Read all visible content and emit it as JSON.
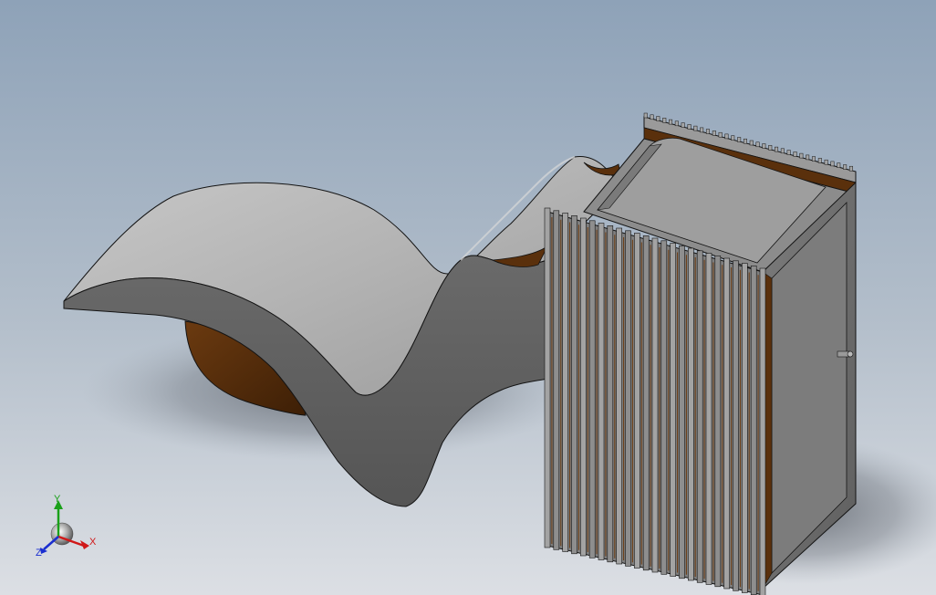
{
  "viewport": {
    "background_top": "#8ea2b8",
    "background_bottom": "#d9dde3"
  },
  "model": {
    "surface_color": "#6e6e6e",
    "surface_light": "#b9b9b9",
    "interior_color": "#4a2a0c",
    "edge_color": "#141414",
    "fin_color": "#8a8a8a"
  },
  "triad": {
    "x_label": "X",
    "y_label": "Y",
    "z_label": "Z",
    "x_color": "#d01818",
    "y_color": "#1aa01a",
    "z_color": "#1a2ed0"
  }
}
